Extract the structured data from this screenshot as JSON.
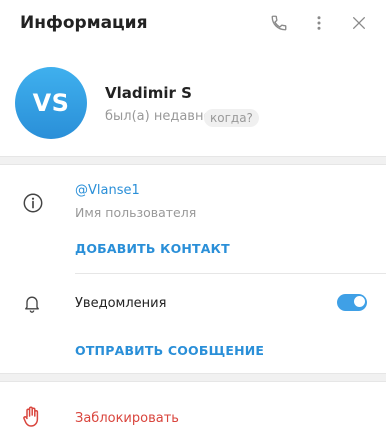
{
  "header": {
    "title": "Информация"
  },
  "profile": {
    "avatar_initials": "VS",
    "name": "Vladimir S",
    "status": "был(а) недавно",
    "when_chip": "когда?"
  },
  "info": {
    "username": "@Vlanse1",
    "username_label": "Имя пользователя",
    "add_contact": "ДОБАВИТЬ КОНТАКТ"
  },
  "notifications": {
    "label": "Уведомления",
    "enabled": true
  },
  "actions": {
    "send_message": "ОТПРАВИТЬ СООБЩЕНИЕ",
    "block": "Заблокировать"
  },
  "colors": {
    "accent": "#2a8fd8",
    "danger": "#d9453d",
    "avatar": "#3fa0e6"
  },
  "icons": [
    "phone-icon",
    "more-vertical-icon",
    "close-icon",
    "info-icon",
    "bell-icon",
    "hand-stop-icon"
  ]
}
